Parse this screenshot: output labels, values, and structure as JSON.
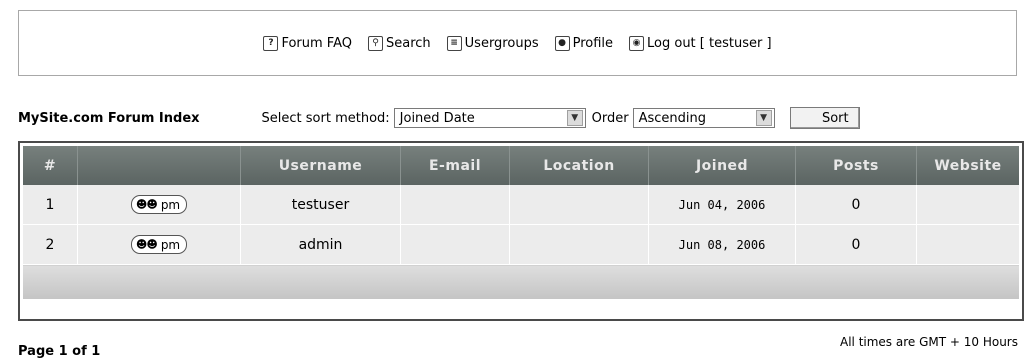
{
  "nav": {
    "items": [
      {
        "label": "Forum FAQ",
        "icon": "help-icon"
      },
      {
        "label": "Search",
        "icon": "search-icon"
      },
      {
        "label": "Usergroups",
        "icon": "usergroups-icon"
      },
      {
        "label": "Profile",
        "icon": "profile-icon"
      },
      {
        "label": "Log out [ testuser ]",
        "icon": "logout-icon"
      }
    ]
  },
  "sort": {
    "forum_index": "MySite.com Forum Index",
    "method_label": "Select sort method:",
    "method_value": "Joined Date",
    "order_label": "Order",
    "order_value": "Ascending",
    "button": "Sort"
  },
  "table": {
    "headers": [
      "#",
      "",
      "Username",
      "E-mail",
      "Location",
      "Joined",
      "Posts",
      "Website"
    ],
    "pm_label": "pm",
    "rows": [
      {
        "num": "1",
        "username": "testuser",
        "email": "",
        "location": "",
        "joined": "Jun 04, 2006",
        "posts": "0",
        "website": ""
      },
      {
        "num": "2",
        "username": "admin",
        "email": "",
        "location": "",
        "joined": "Jun 08, 2006",
        "posts": "0",
        "website": ""
      }
    ]
  },
  "footer": {
    "page": "Page 1 of 1",
    "timezone": "All times are GMT + 10 Hours"
  }
}
